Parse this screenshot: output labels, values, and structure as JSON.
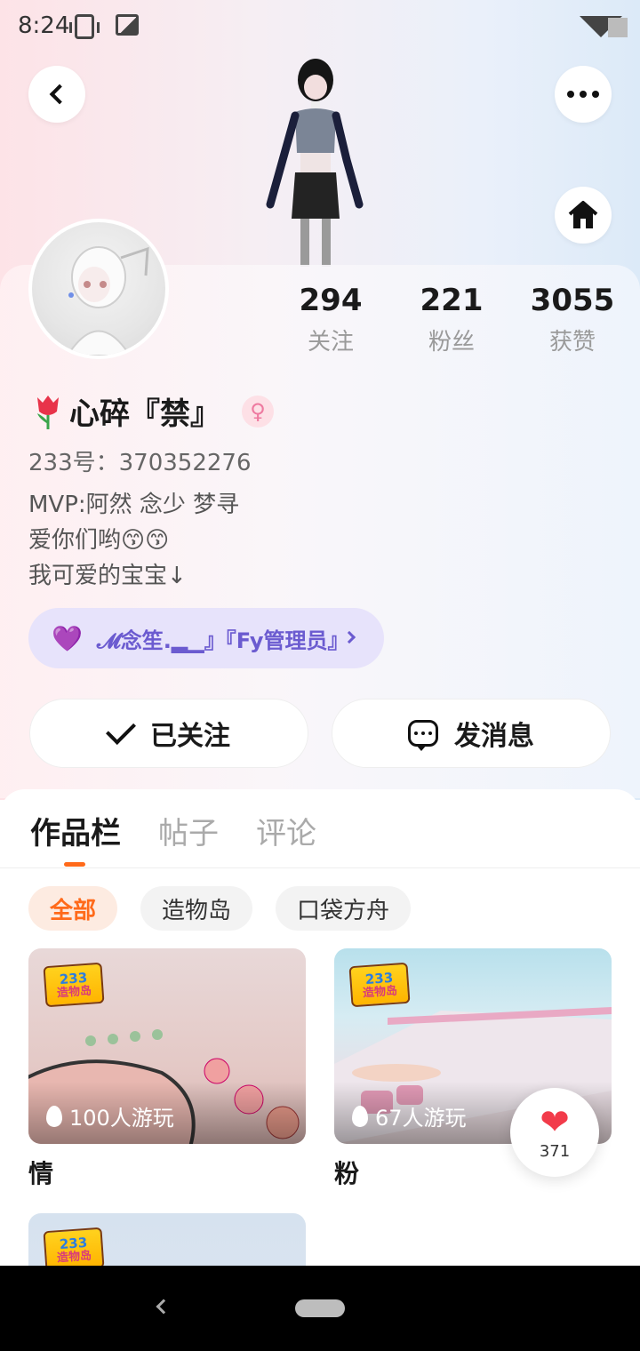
{
  "status_bar": {
    "time": "8:24"
  },
  "icons": {
    "back": "chevron-left-icon",
    "more": "more-dots-icon",
    "home": "home-icon",
    "gender": "female-icon",
    "like": "heart-icon"
  },
  "profile": {
    "name": "心碎『禁』",
    "gender_symbol": "♀",
    "id_text": "233号：370352276",
    "bio": [
      "MVP:阿然 念少 梦寻",
      "爱你们哟😙😙",
      "我可爱的宝宝↓"
    ]
  },
  "stats": [
    {
      "value": "294",
      "label": "关注"
    },
    {
      "value": "221",
      "label": "粉丝"
    },
    {
      "value": "3055",
      "label": "获赞"
    }
  ],
  "guild": {
    "text": "𝓜念笙.▂▁』『Fy管理员』"
  },
  "actions": {
    "follow_label": "已关注",
    "message_label": "发消息"
  },
  "tabs": [
    "作品栏",
    "帖子",
    "评论"
  ],
  "filters": [
    "全部",
    "造物岛",
    "口袋方舟"
  ],
  "badge": {
    "line1": "233",
    "line2": "造物岛"
  },
  "cards": [
    {
      "title": "情",
      "players": "100人游玩"
    },
    {
      "title": "粉",
      "players": "67人游玩"
    },
    {
      "title": "",
      "players": ""
    }
  ],
  "like_float": {
    "count": "371"
  },
  "colors": {
    "accent": "#ff6a1a",
    "guild": "#6b5bd0",
    "heart": "#f23b4a"
  }
}
